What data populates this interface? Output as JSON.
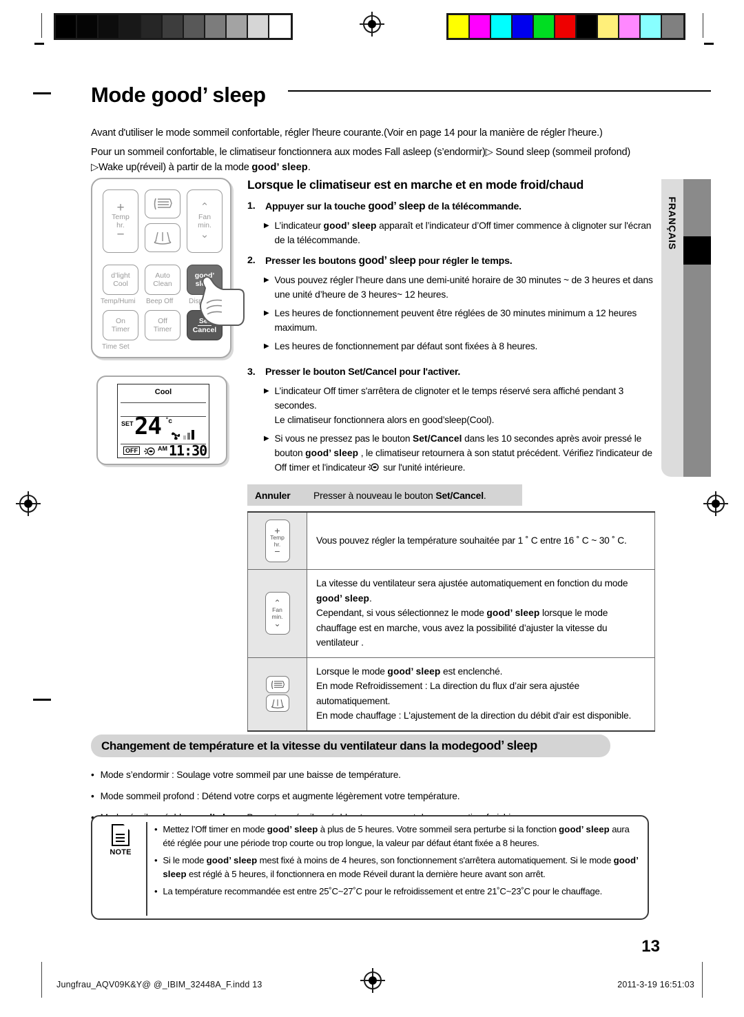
{
  "document": {
    "title_prefix": "Mode ",
    "title_brand": "good’ sleep",
    "page_number": "13",
    "language_tab": "FRANÇAIS"
  },
  "intro": {
    "line1": "Avant d'utiliser le mode sommeil confortable, régler l'heure courante.(Voir en page 14 pour la manière de régler l'heure.)",
    "line2a": "Pour un sommeil confortable, le climatiseur fonctionnera aux modes Fall asleep (s’endormir)",
    "line2b": " Sound sleep (sommeil profond)",
    "line3a": "Wake up(réveil) à partir de la mode ",
    "line3b": "good’ sleep",
    "line3c": "."
  },
  "remote": {
    "buttons": {
      "temp_plus": "+",
      "temp_label1": "Temp",
      "temp_label2": "hr.",
      "temp_minus": "−",
      "fan_up": "⌃",
      "fan_label1": "Fan",
      "fan_label2": "min.",
      "fan_down": "⌄",
      "dlight": "d’light",
      "cool": "Cool",
      "auto": "Auto",
      "clean": "Clean",
      "good": "good’",
      "sleep": "sleep",
      "on": "On",
      "timer1": "Timer",
      "off": "Off",
      "timer2": "Timer",
      "set": "Set",
      "cancel": "Cancel"
    },
    "captions": {
      "temp_humi": "Temp/Humi",
      "beep_off": "Beep Off",
      "display": "Display",
      "time_set": "Time Set"
    }
  },
  "lcd": {
    "mode": "Cool",
    "set_label": "SET",
    "temperature": "24",
    "unit": "˚c",
    "off_badge": "OFF",
    "meridiem": "AM",
    "time": "11:30"
  },
  "instructions": {
    "heading": "Lorsque le climatiseur est en marche et en mode froid/chaud",
    "steps": [
      {
        "num": "1.",
        "text_a": "Appuyer sur la touche ",
        "brand": "good’ sleep",
        "text_b": " de la télécommande."
      },
      {
        "num": "2.",
        "text_a": "Presser les boutons ",
        "brand": "good’ sleep",
        "text_b": " pour régler le temps."
      },
      {
        "num": "3.",
        "text_a": "Presser le bouton ",
        "brand": "Set/Cancel",
        "text_b": " pour l'activer."
      }
    ],
    "bullets_1": [
      {
        "a": "L’indicateur ",
        "brand": "good’ sleep",
        "b": " apparaît et  l’indicateur d’Off timer commence à clignoter sur l'écran de la télécommande."
      }
    ],
    "bullets_2": [
      {
        "a": "Vous pouvez régler l’heure dans une demi-unité horaire de 30 minutes ~ de 3 heures et dans une unité d’heure de 3 heures~ 12 heures.",
        "brand": "",
        "b": ""
      },
      {
        "a": "Les heures de fonctionnement peuvent être réglées de 30 minutes minimum a 12 heures maximum.",
        "brand": "",
        "b": ""
      },
      {
        "a": "Les heures de fonctionnement par défaut sont fixées à 8 heures.",
        "brand": "",
        "b": ""
      }
    ],
    "bullets_3": [
      {
        "a": "L’indicateur Off timer s'arrêtera de clignoter et le temps réservé sera affiché pendant 3 secondes.",
        "extra": "Le climatiseur fonctionnera alors en good’sleep(Cool)."
      }
    ],
    "bullet_3b": {
      "a": "Si vous ne pressez pas le bouton ",
      "brand1": "Set/Cancel",
      "b": " dans les 10 secondes après avoir pressé le bouton ",
      "brand2": "good’ sleep",
      "c": " , le climatiseur retournera  à son statut précédent.  Vérifiez l'indicateur de Off timer et l'indicateur ",
      "d": " sur l'unité intérieure."
    }
  },
  "cancel_row": {
    "label": "Annuler",
    "text_a": "Presser à nouveau le bouton ",
    "brand": "Set/Cancel",
    "text_b": "."
  },
  "table": {
    "rows": [
      {
        "icon": "temp-button-icon",
        "icon_top": "+",
        "icon_l1": "Temp",
        "icon_l2": "hr.",
        "icon_bottom": "−",
        "lines": [
          {
            "a": "Vous pouvez régler la température souhaitée par 1 ˚ C entre 16 ˚ C ~ 30 ˚ C.",
            "brand": "",
            "b": ""
          }
        ]
      },
      {
        "icon": "fan-button-icon",
        "icon_top": "⌃",
        "icon_l1": "Fan",
        "icon_l2": "min.",
        "icon_bottom": "⌄",
        "lines": [
          {
            "a": "La vitesse du ventilateur sera ajustée automatiquement en fonction du mode ",
            "brand": "good’ sleep",
            "b": "."
          },
          {
            "a": "Cependant, si vous sélectionnez le mode ",
            "brand": "good’ sleep",
            "b": " lorsque le mode chauffage est en marche, vous avez la possibilité d’ajuster la vitesse du ventilateur ."
          }
        ]
      },
      {
        "icon": "swing-button-icon",
        "icon_top": "",
        "icon_l1": "",
        "icon_l2": "",
        "icon_bottom": "",
        "lines": [
          {
            "a": "Lorsque le mode ",
            "brand": "good’ sleep",
            "b": " est enclenché."
          },
          {
            "a": "En mode Refroidissement : La direction du flux d’air sera ajustée automatiquement.",
            "brand": "",
            "b": ""
          },
          {
            "a": "En mode chauffage : L'ajustement de la direction du débit d'air est disponible.",
            "brand": "",
            "b": ""
          }
        ]
      }
    ]
  },
  "section2": {
    "heading_a": "Changement de température et la vitesse du ventilateur dans la mode ",
    "heading_brand": "good’ sleep",
    "bullets": [
      {
        "a": "Mode s’endormir : Soulage votre sommeil par une baisse de température.",
        "brand": "",
        "b": ""
      },
      {
        "a": "Mode sommeil profond : Détend votre corps et augmente légèrement votre température.",
        "brand": "",
        "b": ""
      },
      {
        "a": "Mode réveil agréable ",
        "brand": "good’ sleep",
        "b": ": Permet un réveil agréable et vous permet de vous sentir rafraichi."
      }
    ]
  },
  "note": {
    "label": "NOTE",
    "items": [
      {
        "a": " Mettez l’Off timer en mode ",
        "brand1": "good’ sleep",
        "b": " à plus de 5 heures. Votre sommeil sera perturbe si la fonction ",
        "brand2": "good’ sleep",
        "c": " aura été réglée pour une période trop courte ou trop longue, la valeur par défaut étant fixée a 8 heures."
      },
      {
        "a": "Si le mode ",
        "brand1": "good’ sleep",
        "b": " mest fixé à moins de 4 heures, son fonctionnement s'arrêtera automatiquement. Si le mode ",
        "brand2": "good’ sleep",
        "c": " est réglé à 5 heures, il fonctionnera en mode Réveil durant la dernière heure avant son arrêt."
      },
      {
        "a": "La température recommandée est entre 25˚C~27˚C pour le refroidissement et entre 21˚C~23˚C pour le chauffage.",
        "brand1": "",
        "b": "",
        "brand2": "",
        "c": ""
      }
    ]
  },
  "footer": {
    "filename": "Jungfrau_AQV09K&Y@ @_IBIM_32448A_F.indd   13",
    "timestamp": "2011-3-19   16:51:03"
  },
  "calibration": {
    "grayscale": [
      "#000000",
      "#050505",
      "#0d0d0d",
      "#181818",
      "#262626",
      "#3d3d3d",
      "#585858",
      "#7c7c7c",
      "#a3a3a3",
      "#d6d6d6",
      "#ffffff"
    ],
    "colors": [
      "#ffff00",
      "#ff00ff",
      "#00ffff",
      "#0000ee",
      "#00dd22",
      "#ee0000",
      "#000000",
      "#ffef7a",
      "#ff88ff",
      "#88ffff",
      "#808080"
    ]
  }
}
